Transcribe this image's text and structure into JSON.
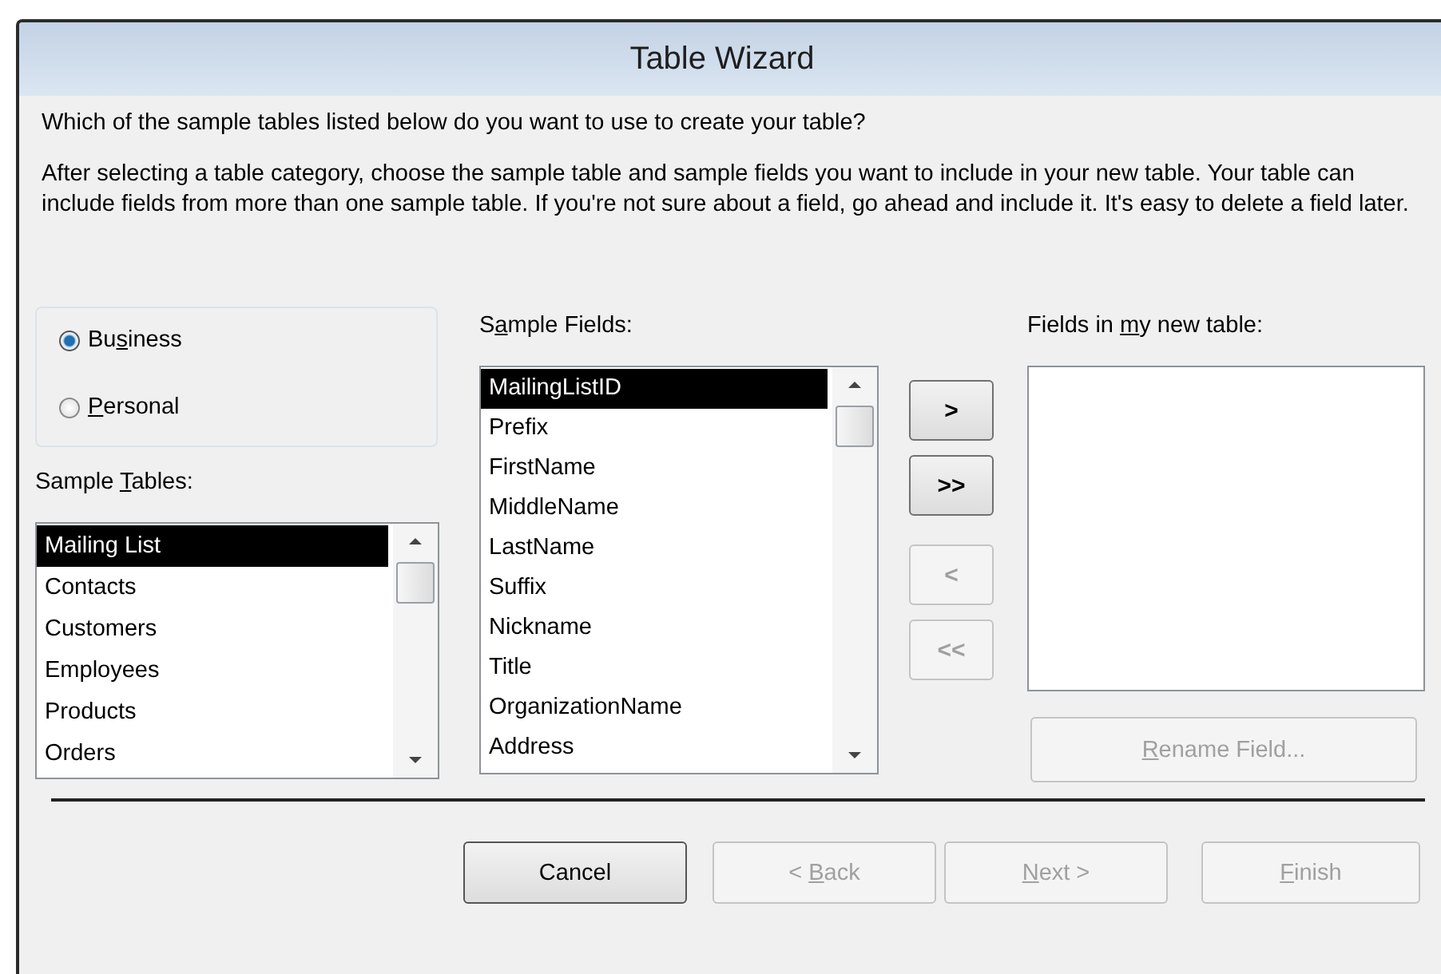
{
  "window": {
    "title": "Table Wizard"
  },
  "question": "Which of the sample tables listed below do you want to use to create your table?",
  "instructions": "After selecting a table category, choose the sample table and sample fields you want to include in your new table. Your table can include fields from more than one sample table. If you're not sure about a field, go ahead and include it. It's easy to delete a field later.",
  "categories": [
    {
      "label": {
        "before": "Bu",
        "key": "s",
        "after": "iness"
      },
      "selected": true
    },
    {
      "label": {
        "key": "P",
        "after": "ersonal"
      },
      "selected": false
    }
  ],
  "sample_tables": {
    "label": {
      "before": "Sample ",
      "key": "T",
      "after": "ables:"
    },
    "items": [
      {
        "text": "Mailing List",
        "selected": true
      },
      {
        "text": "Contacts",
        "selected": false
      },
      {
        "text": "Customers",
        "selected": false
      },
      {
        "text": "Employees",
        "selected": false
      },
      {
        "text": "Products",
        "selected": false
      },
      {
        "text": "Orders",
        "selected": false
      }
    ]
  },
  "sample_fields": {
    "label": {
      "before": "S",
      "key": "a",
      "after": "mple Fields:"
    },
    "items": [
      {
        "text": "MailingListID",
        "selected": true
      },
      {
        "text": "Prefix",
        "selected": false
      },
      {
        "text": "FirstName",
        "selected": false
      },
      {
        "text": "MiddleName",
        "selected": false
      },
      {
        "text": "LastName",
        "selected": false
      },
      {
        "text": "Suffix",
        "selected": false
      },
      {
        "text": "Nickname",
        "selected": false
      },
      {
        "text": "Title",
        "selected": false
      },
      {
        "text": "OrganizationName",
        "selected": false
      },
      {
        "text": "Address",
        "selected": false
      }
    ]
  },
  "move_buttons": [
    {
      "label": ">",
      "disabled": false
    },
    {
      "label": ">>",
      "disabled": false
    },
    {
      "label": "<",
      "disabled": true
    },
    {
      "label": "<<",
      "disabled": true
    }
  ],
  "new_table": {
    "label": {
      "before": "Fields in ",
      "key": "m",
      "after": "y new table:"
    }
  },
  "rename_button": {
    "label": {
      "key": "R",
      "after": "ename Field..."
    },
    "disabled": true
  },
  "footer_buttons": [
    {
      "label": {
        "before": "Cancel"
      },
      "disabled": false
    },
    {
      "label": {
        "before": "< ",
        "key": "B",
        "after": "ack"
      },
      "disabled": true
    },
    {
      "label": {
        "key": "N",
        "after": "ext >"
      },
      "disabled": true
    },
    {
      "label": {
        "key": "F",
        "after": "inish"
      },
      "disabled": true
    }
  ]
}
